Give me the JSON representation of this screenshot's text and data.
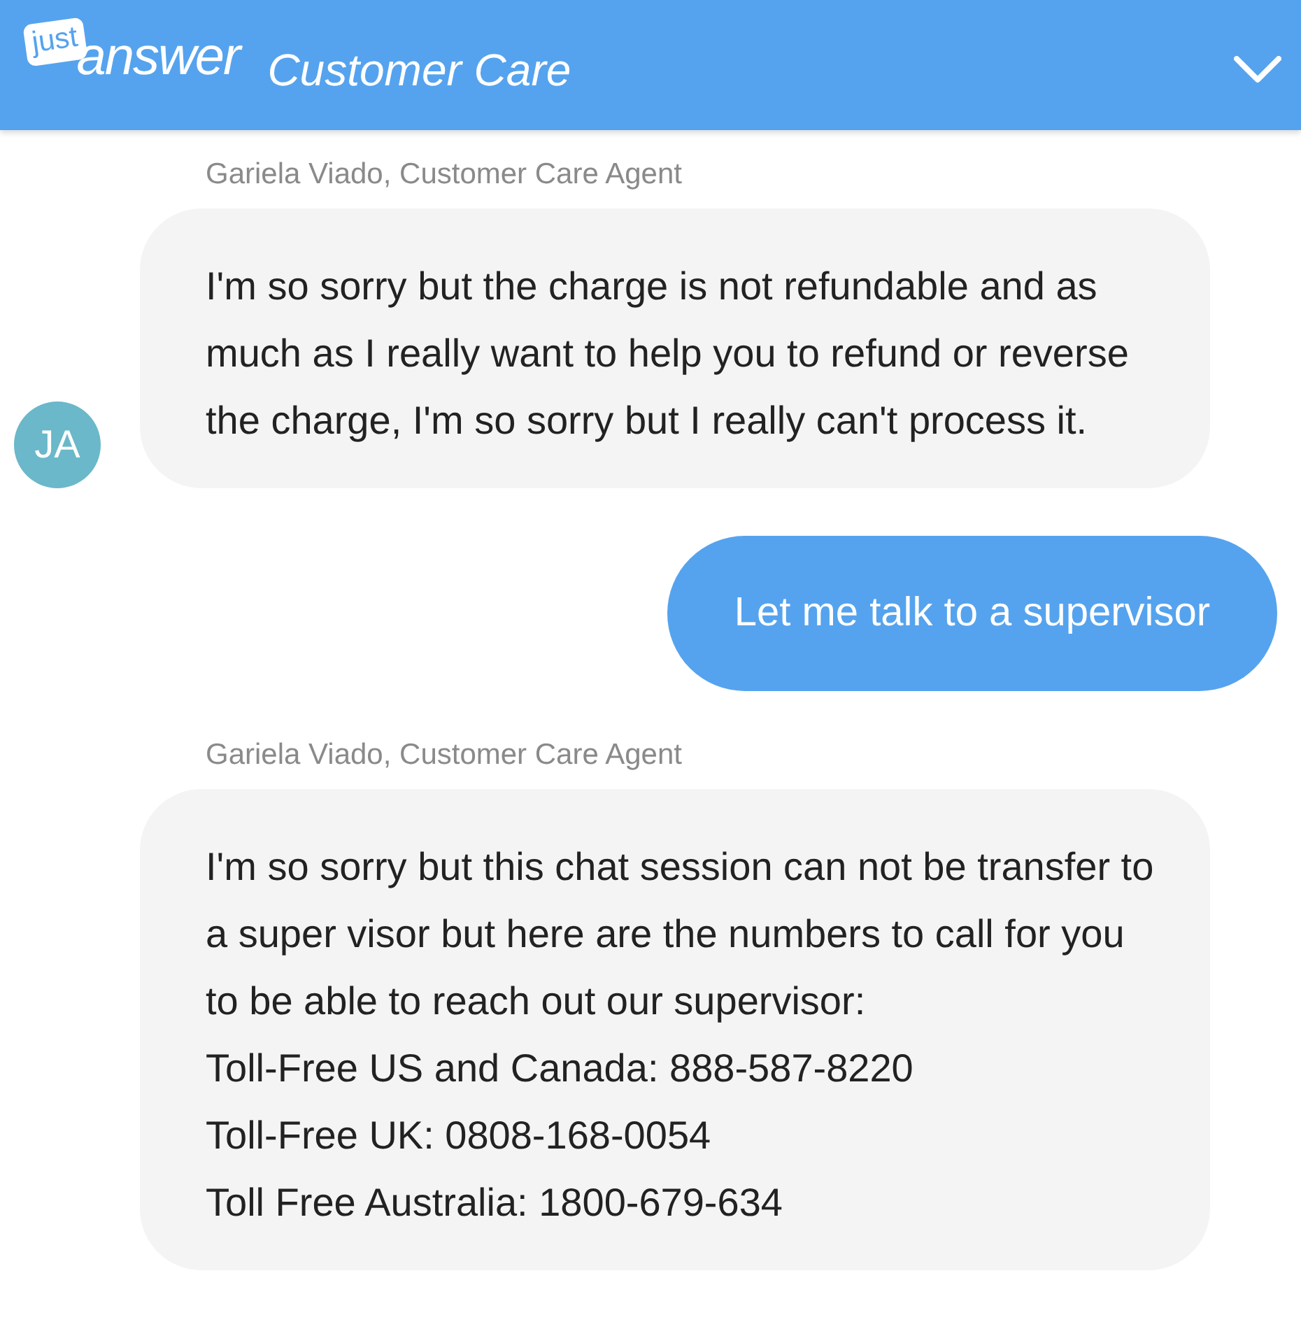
{
  "header": {
    "logo_badge": "just",
    "logo_word": "answer",
    "title": "Customer Care"
  },
  "messages": [
    {
      "kind": "agent",
      "sender": "Gariela Viado, Customer Care Agent",
      "avatar": "JA",
      "paragraphs": [
        "I'm so sorry but the charge is not refundable and as much as I really want to help you to refund or reverse the charge, I'm so sorry but I really can't process it."
      ]
    },
    {
      "kind": "user",
      "paragraphs": [
        "Let me talk to a supervisor"
      ]
    },
    {
      "kind": "agent",
      "sender": "Gariela Viado, Customer Care Agent",
      "paragraphs": [
        "I'm so sorry but this chat session can not be transfer to a super visor but here are the numbers to call for you to be able to reach out our supervisor:",
        "Toll-Free US and Canada: 888-587-8220",
        "Toll-Free UK: 0808-168-0054",
        "Toll Free Australia: 1800-679-634"
      ]
    }
  ]
}
